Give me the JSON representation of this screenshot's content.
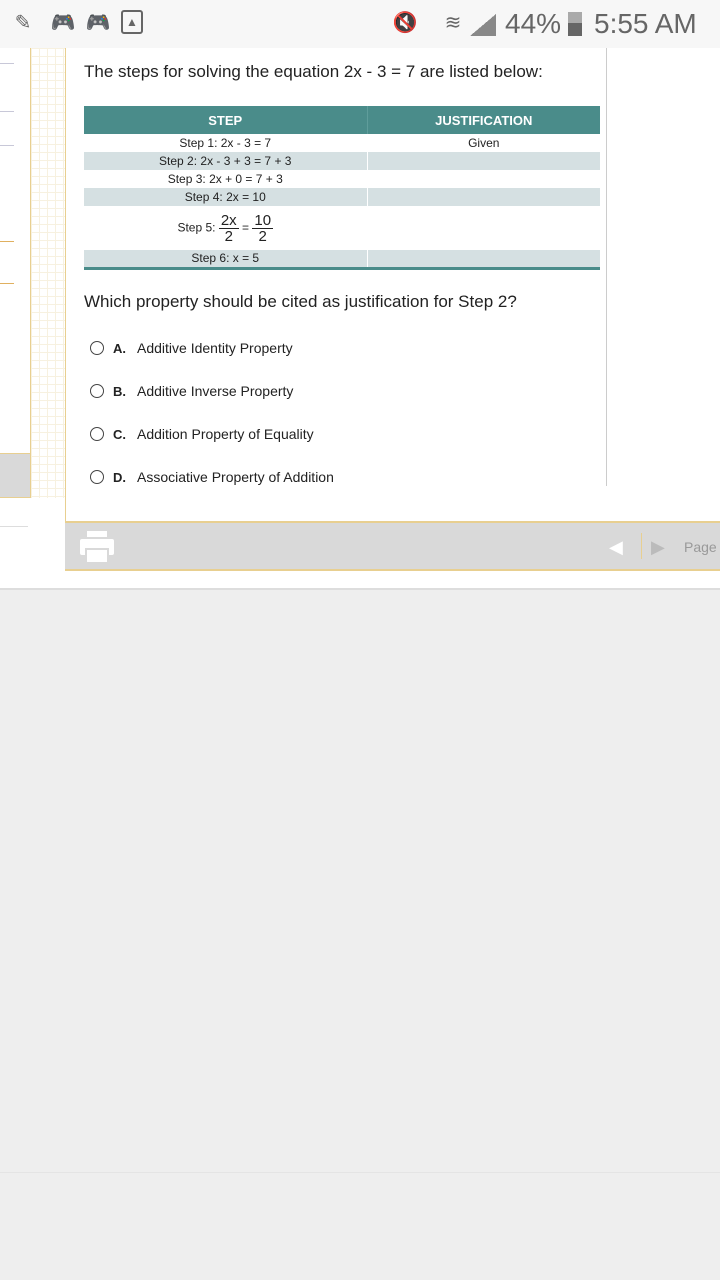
{
  "status_bar": {
    "battery": "44%",
    "time": "5:55 AM",
    "left_icons": [
      "paint-brush-icon",
      "game-controller-chat-icon",
      "game-controller-chat-icon",
      "image-icon"
    ],
    "right_icons": [
      "vibrate-mute-icon",
      "wifi-icon",
      "signal-icon",
      "battery-icon"
    ]
  },
  "question": {
    "intro": "The steps for solving the equation 2x - 3 = 7 are listed below:",
    "table": {
      "headers": [
        "STEP",
        "JUSTIFICATION"
      ],
      "rows": [
        {
          "step": "Step 1: 2x - 3 = 7",
          "justification": "Given"
        },
        {
          "step": "Step 2: 2x - 3 + 3 = 7 + 3",
          "justification": ""
        },
        {
          "step": "Step 3: 2x + 0 = 7 + 3",
          "justification": ""
        },
        {
          "step": "Step 4: 2x = 10",
          "justification": ""
        },
        {
          "step_label": "Step 5:",
          "lhs_num": "2x",
          "lhs_den": "2",
          "eq": "=",
          "rhs_num": "10",
          "rhs_den": "2",
          "justification": ""
        },
        {
          "step": "Step 6: x = 5",
          "justification": ""
        }
      ]
    },
    "prompt": "Which property should be cited as justification for Step 2?",
    "options": [
      {
        "letter": "A.",
        "text": "Additive Identity Property"
      },
      {
        "letter": "B.",
        "text": "Additive Inverse Property"
      },
      {
        "letter": "C.",
        "text": "Addition Property of Equality"
      },
      {
        "letter": "D.",
        "text": "Associative Property of Addition"
      }
    ]
  },
  "footer": {
    "page_label": "Page"
  },
  "colors": {
    "table_header": "#4a8c8a",
    "row_alt": "#d5e0e2",
    "accent_border": "#e8cf90"
  }
}
